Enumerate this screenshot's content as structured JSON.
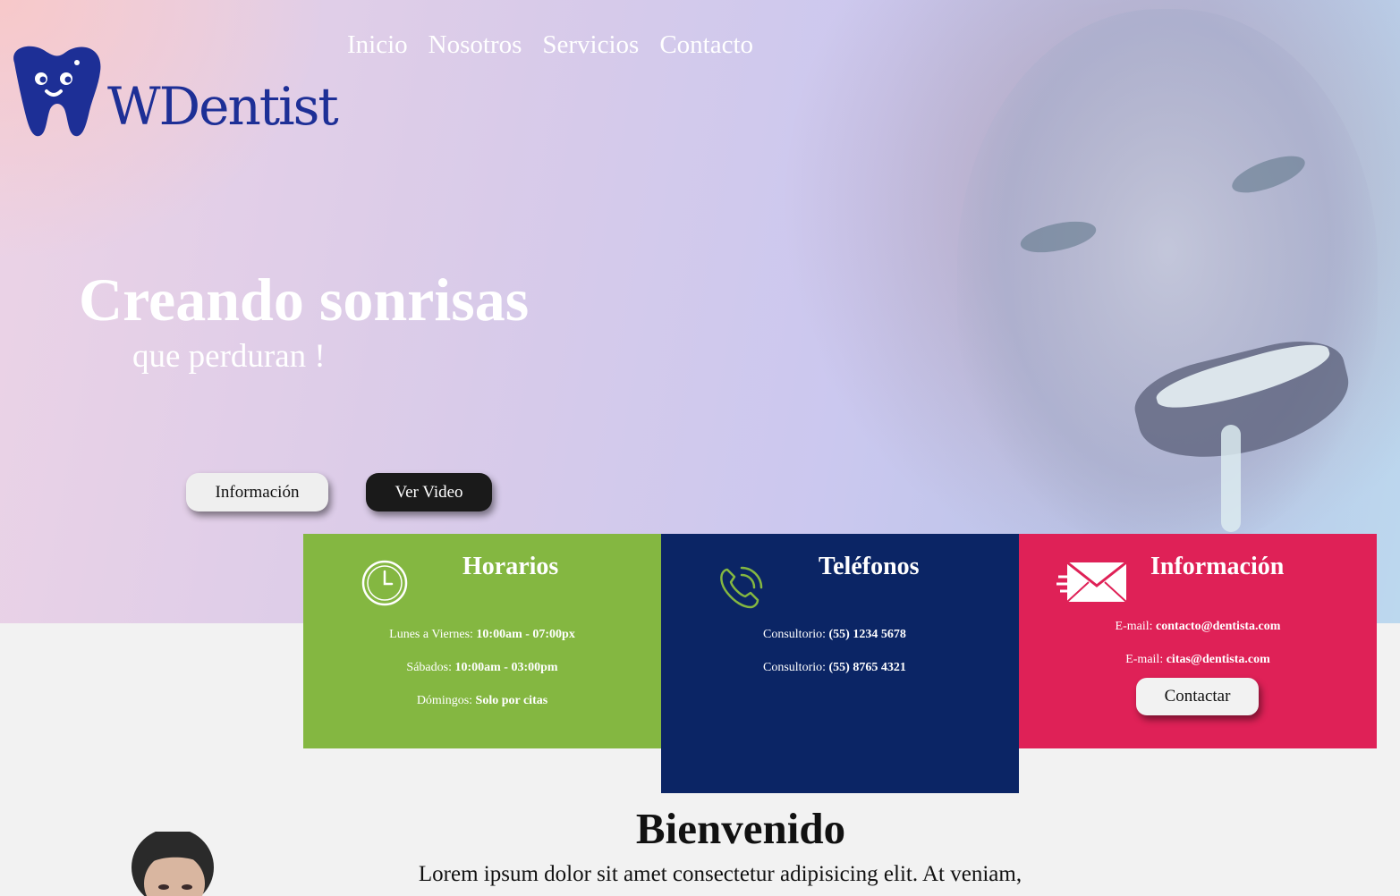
{
  "brand": {
    "name": "WDentist",
    "color": "#1d2f96"
  },
  "nav": {
    "items": [
      "Inicio",
      "Nosotros",
      "Servicios",
      "Contacto"
    ]
  },
  "hero": {
    "title": "Creando sonrisas",
    "subtitle": "que perduran !",
    "buttons": {
      "info": "Información",
      "video": "Ver Video"
    }
  },
  "cards": {
    "hours": {
      "title": "Horarios",
      "color": "#84b741",
      "icon": "clock-icon",
      "lines": [
        {
          "label": "Lunes a Viernes: ",
          "value": "10:00am - 07:00px"
        },
        {
          "label": "Sábados: ",
          "value": "10:00am - 03:00pm"
        },
        {
          "label": "Dómingos: ",
          "value": "Solo por citas"
        }
      ]
    },
    "phones": {
      "title": "Teléfonos",
      "color": "#0b2565",
      "icon": "phone-icon",
      "lines": [
        {
          "label": "Consultorio: ",
          "value": "(55) 1234 5678"
        },
        {
          "label": "Consultorio: ",
          "value": "(55) 8765 4321"
        }
      ]
    },
    "info": {
      "title": "Información",
      "color": "#df2157",
      "icon": "envelope-icon",
      "lines": [
        {
          "label": "E-mail: ",
          "value": "contacto@dentista.com"
        },
        {
          "label": "E-mail: ",
          "value": "citas@dentista.com"
        }
      ],
      "button": "Contactar"
    }
  },
  "welcome": {
    "title": "Bienvenido",
    "text": "Lorem ipsum dolor sit amet consectetur adipisicing elit. At veniam,"
  }
}
